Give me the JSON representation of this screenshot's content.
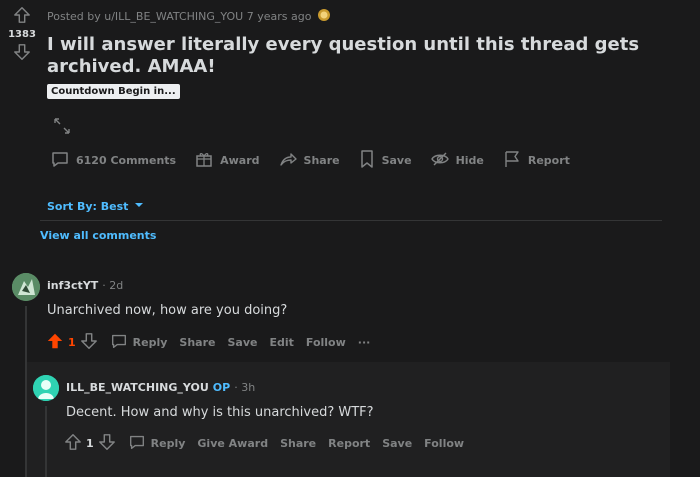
{
  "post": {
    "posted_by": "Posted by u/ILL_BE_WATCHING_YOU 7 years ago",
    "vote_count": "1383",
    "title": "I will answer literally every question until this thread gets archived. AMAA!",
    "flair": "Countdown Begin in...",
    "actions": {
      "comments": "6120 Comments",
      "award": "Award",
      "share": "Share",
      "save": "Save",
      "hide": "Hide",
      "report": "Report"
    }
  },
  "sort": {
    "label": "Sort By: Best"
  },
  "view_all": "View all comments",
  "comments": [
    {
      "user": "inf3ctYT",
      "time": "· 2d",
      "body": "Unarchived now, how are you doing?",
      "votes": "1",
      "actions": {
        "reply": "Reply",
        "share": "Share",
        "save": "Save",
        "edit": "Edit",
        "follow": "Follow",
        "more": "···"
      },
      "vote_state": "upvoted",
      "colors": {
        "upvote": "#ff4500"
      }
    },
    {
      "user": "ILL_BE_WATCHING_YOU",
      "op": "OP",
      "time": "· 3h",
      "body": "Decent. How and why is this unarchived? WTF?",
      "votes": "1",
      "actions": {
        "reply": "Reply",
        "give_award": "Give Award",
        "share": "Share",
        "report": "Report",
        "save": "Save",
        "follow": "Follow"
      }
    }
  ],
  "colors": {
    "background": "#1a1a1b",
    "link": "#4fbcff",
    "muted": "#818384",
    "text": "#d7dadc"
  }
}
